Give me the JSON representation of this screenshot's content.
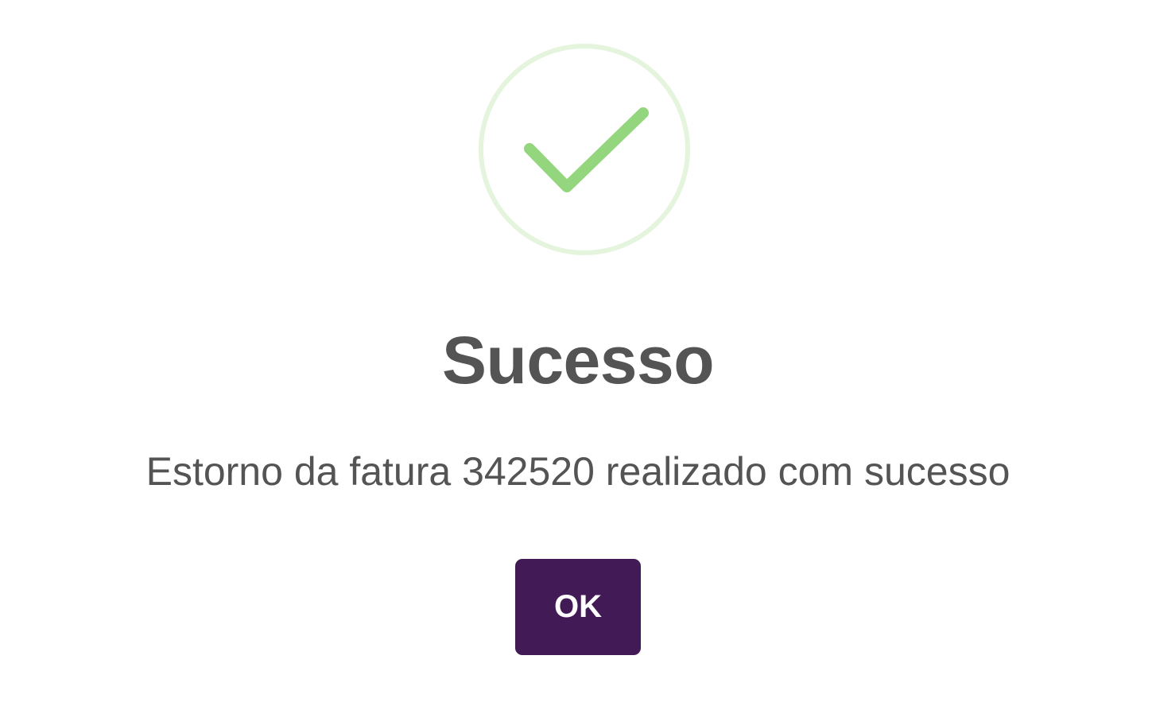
{
  "dialog": {
    "icon": "success-check-icon",
    "title": "Sucesso",
    "message": "Estorno da fatura 342520 realizado com sucesso",
    "ok_label": "OK"
  },
  "colors": {
    "check": "#93d67d",
    "check_ring": "#e4f4dd",
    "title_text": "#545454",
    "button_bg": "#421a55",
    "button_text": "#ffffff"
  }
}
